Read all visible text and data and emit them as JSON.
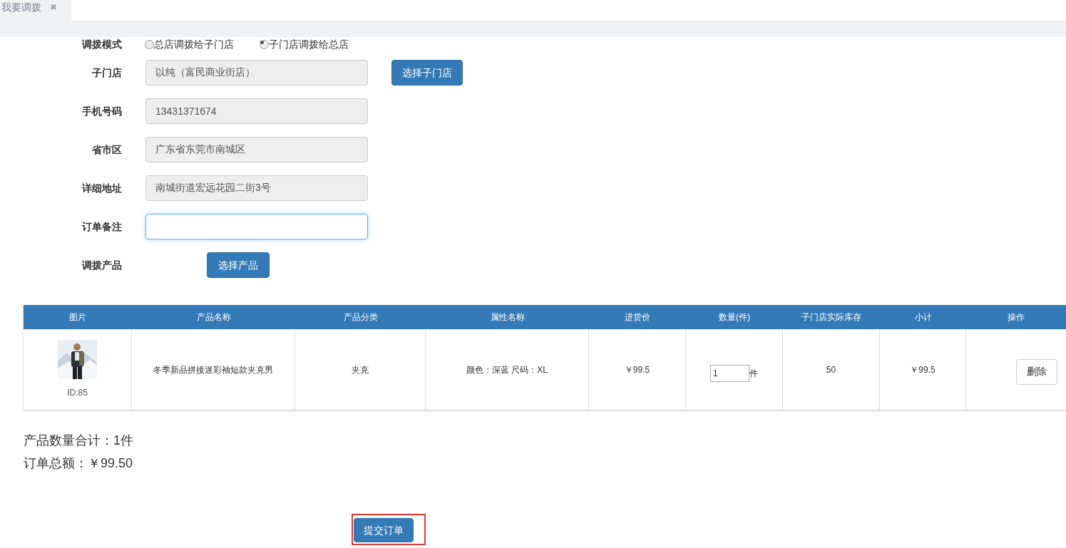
{
  "tabs": [
    {
      "label": "我要调拨",
      "close": "✖",
      "selected": true
    }
  ],
  "transfer_mode": {
    "label": "调拨模式",
    "options": [
      {
        "label": "总店调拨给子门店",
        "selected": false
      },
      {
        "label": "子门店调拨给总店",
        "selected": true
      }
    ]
  },
  "fields": [
    {
      "label": "子门店",
      "value": "以纯（富民商业街店）",
      "disabled": true,
      "button": "选择子门店"
    },
    {
      "label": "手机号码",
      "value": "13431371674",
      "disabled": true
    },
    {
      "label": "省市区",
      "value": "广东省东莞市南城区",
      "disabled": true
    },
    {
      "label": "详细地址",
      "value": "南城街道宏远花园二街3号",
      "disabled": true
    },
    {
      "label": "订单备注",
      "disabled": false
    }
  ],
  "products_label": "调拨产品",
  "select_products_button": "选择产品",
  "table": {
    "columns": [
      "图片",
      "产品名称",
      "产品分类",
      "属性名称",
      "进货价",
      "数量(件)",
      "子门店实际库存",
      "小计",
      "操作"
    ],
    "rows": [
      {
        "id": "ID:85",
        "name": "冬季新品拼接迷彩袖短款夹克男",
        "category": "夹克",
        "attributes": "颜色：深蓝 尺码：XL",
        "price": "￥99.5",
        "quantity": "1",
        "unit": "件",
        "stock": "50",
        "subtotal": "￥99.5",
        "action": "删除"
      }
    ]
  },
  "summary": [
    "产品数量合计：1件",
    "订单总额：￥99.50"
  ],
  "submit_button": "提交订单"
}
